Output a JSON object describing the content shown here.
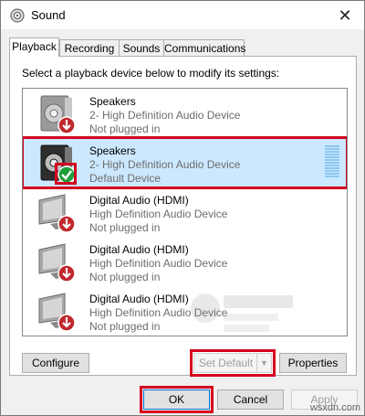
{
  "window": {
    "title": "Sound",
    "close_glyph": "✕"
  },
  "tabs": [
    {
      "label": "Playback",
      "active": true
    },
    {
      "label": "Recording",
      "active": false
    },
    {
      "label": "Sounds",
      "active": false
    },
    {
      "label": "Communications",
      "active": false
    }
  ],
  "playback": {
    "instruction": "Select a playback device below to modify its settings:",
    "devices": [
      {
        "name": "Speakers",
        "description": "2- High Definition Audio Device",
        "status": "Not plugged in",
        "icon": "speaker-icon",
        "badge": "red-down-arrow-icon",
        "selected": false
      },
      {
        "name": "Speakers",
        "description": "2- High Definition Audio Device",
        "status": "Default Device",
        "icon": "speaker-icon",
        "badge": "green-check-icon",
        "selected": true
      },
      {
        "name": "Digital Audio (HDMI)",
        "description": "High Definition Audio Device",
        "status": "Not plugged in",
        "icon": "monitor-icon",
        "badge": "red-down-arrow-icon",
        "selected": false
      },
      {
        "name": "Digital Audio (HDMI)",
        "description": "High Definition Audio Device",
        "status": "Not plugged in",
        "icon": "monitor-icon",
        "badge": "red-down-arrow-icon",
        "selected": false
      },
      {
        "name": "Digital Audio (HDMI)",
        "description": "High Definition Audio Device",
        "status": "Not plugged in",
        "icon": "monitor-icon",
        "badge": "red-down-arrow-icon",
        "selected": false
      }
    ],
    "buttons": {
      "configure": "Configure",
      "set_default": "Set Default",
      "properties": "Properties"
    }
  },
  "footer": {
    "ok": "OK",
    "cancel": "Cancel",
    "apply": "Apply"
  },
  "watermark": {
    "text": "wsxdn.com"
  },
  "colors": {
    "selection": "#cce8ff",
    "highlight": "#d4001f",
    "badge_red": "#c0282d",
    "badge_green": "#1e9e3a"
  }
}
